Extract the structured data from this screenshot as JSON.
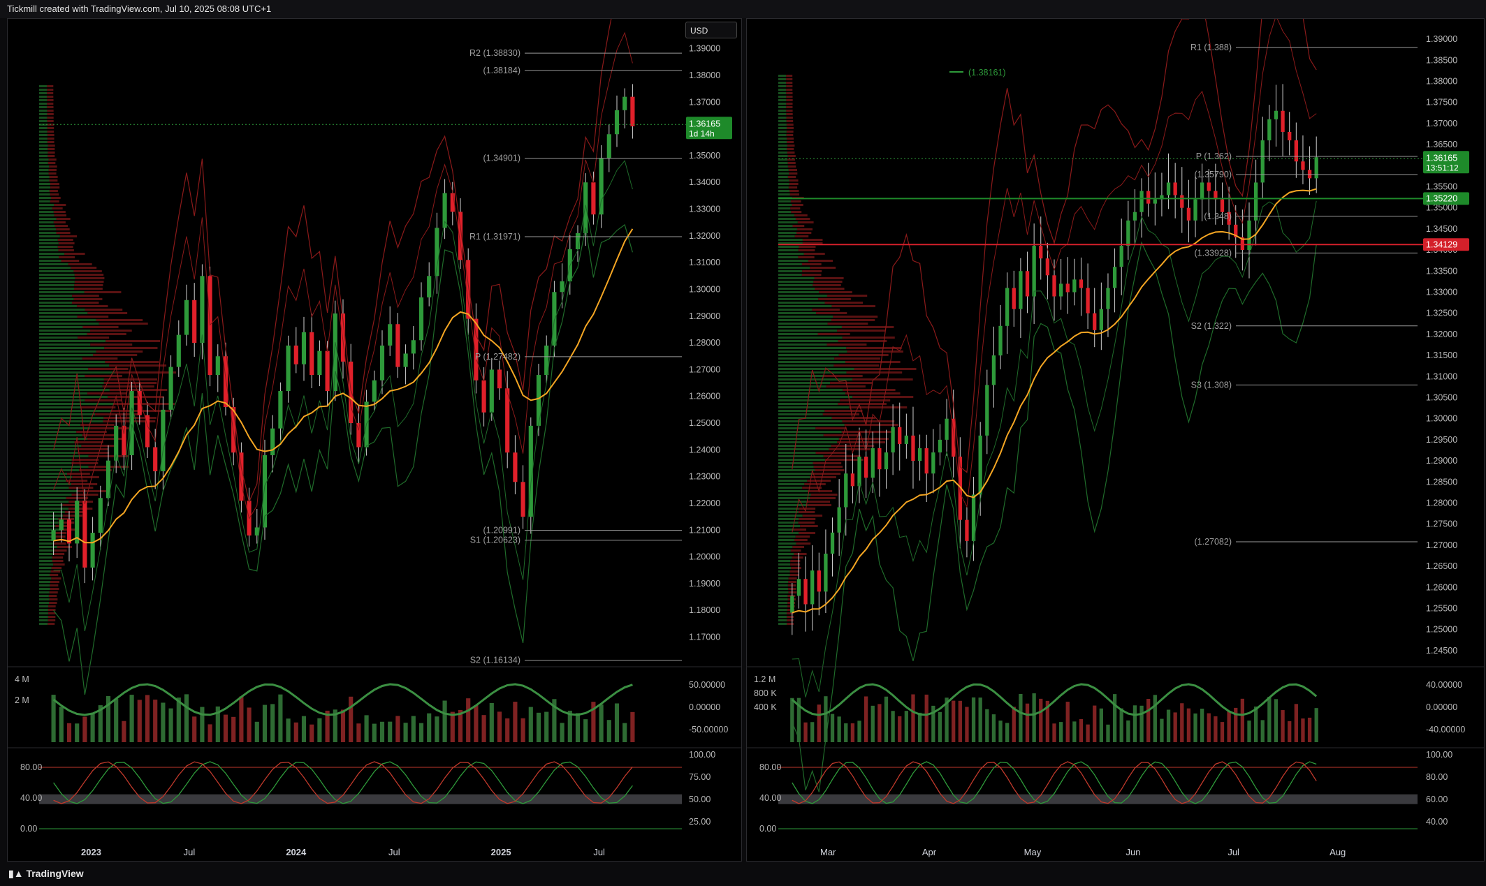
{
  "header": {
    "attribution": "Tickmill created with TradingView.com, Jul 10, 2025 08:08 UTC+1"
  },
  "footer": {
    "brand": "TradingView"
  },
  "colors": {
    "up": "#2e9a3a",
    "down": "#e0202a",
    "pivot": "#9a9a9a",
    "ma": "#f5a623",
    "bb_red": "#8b1a1a",
    "bb_green": "#1f6b2a"
  },
  "chart_data": [
    {
      "type": "candlestick",
      "title": "",
      "currency_button": "USD",
      "x_ticks": [
        "2023",
        "Jul",
        "2024",
        "Jul",
        "2025",
        "Jul"
      ],
      "y_ticks": [
        "1.39000",
        "1.38000",
        "1.37000",
        "1.36000",
        "1.35000",
        "1.34000",
        "1.33000",
        "1.32000",
        "1.31000",
        "1.30000",
        "1.29000",
        "1.28000",
        "1.27000",
        "1.26000",
        "1.25000",
        "1.24000",
        "1.23000",
        "1.22000",
        "1.21000",
        "1.20000",
        "1.19000",
        "1.18000",
        "1.17000"
      ],
      "ylim": [
        1.161,
        1.392
      ],
      "last_price": {
        "value": "1.36165",
        "countdown": "1d 14h"
      },
      "levels": [
        {
          "label": "R2 (1.38830)",
          "value": 1.3883
        },
        {
          "label": "(1.38184)",
          "value": 1.38184
        },
        {
          "label": "(1.34901)",
          "value": 1.34901
        },
        {
          "label": "R1 (1.31971)",
          "value": 1.31971
        },
        {
          "label": "P (1.27482)",
          "value": 1.27482
        },
        {
          "label": "(1.20991)",
          "value": 1.20991
        },
        {
          "label": "S1 (1.20623)",
          "value": 1.20623
        },
        {
          "label": "S2 (1.16134)",
          "value": 1.16134
        }
      ],
      "closes": [
        1.21,
        1.214,
        1.205,
        1.221,
        1.196,
        1.209,
        1.222,
        1.236,
        1.249,
        1.238,
        1.262,
        1.253,
        1.241,
        1.232,
        1.255,
        1.271,
        1.283,
        1.296,
        1.28,
        1.305,
        1.268,
        1.275,
        1.256,
        1.239,
        1.221,
        1.208,
        1.211,
        1.238,
        1.248,
        1.262,
        1.279,
        1.272,
        1.284,
        1.268,
        1.277,
        1.262,
        1.291,
        1.273,
        1.25,
        1.241,
        1.258,
        1.266,
        1.279,
        1.287,
        1.271,
        1.276,
        1.281,
        1.297,
        1.305,
        1.323,
        1.336,
        1.329,
        1.311,
        1.289,
        1.266,
        1.254,
        1.27,
        1.263,
        1.239,
        1.228,
        1.215,
        1.249,
        1.268,
        1.279,
        1.299,
        1.303,
        1.315,
        1.321,
        1.34,
        1.328,
        1.349,
        1.358,
        1.367,
        1.372,
        1.361
      ],
      "volume": {
        "y_ticks": [
          "4 M",
          "2 M"
        ]
      },
      "oscillator_a": {
        "y_ticks": [
          "50.00000",
          "0.00000",
          "-50.00000"
        ]
      },
      "oscillator_b": {
        "y_ticks_left": [
          "80.00",
          "40.00",
          "0.00"
        ],
        "y_ticks_right": [
          "100.00",
          "75.00",
          "50.00",
          "25.00"
        ]
      }
    },
    {
      "type": "candlestick",
      "title": "",
      "x_ticks": [
        "Mar",
        "Apr",
        "May",
        "Jun",
        "Jul",
        "Aug"
      ],
      "y_ticks": [
        "1.39000",
        "1.38500",
        "1.38000",
        "1.37500",
        "1.37000",
        "1.36500",
        "1.36000",
        "1.35500",
        "1.35000",
        "1.34500",
        "1.34000",
        "1.33500",
        "1.33000",
        "1.32500",
        "1.32000",
        "1.31500",
        "1.31000",
        "1.30500",
        "1.30000",
        "1.29500",
        "1.29000",
        "1.28500",
        "1.28000",
        "1.27500",
        "1.27000",
        "1.26500",
        "1.26000",
        "1.25500",
        "1.25000",
        "1.24500"
      ],
      "ylim": [
        1.2425,
        1.3915
      ],
      "legend_value": "(1.38161)",
      "last_price": {
        "value": "1.36165",
        "countdown": "13:51:12"
      },
      "price_tags": [
        {
          "value": "1.35220",
          "color": "#1e8a2a"
        },
        {
          "value": "1.34129",
          "color": "#d4202a"
        }
      ],
      "levels": [
        {
          "label": "R1 (1.388)",
          "value": 1.388
        },
        {
          "label": "(1.35790)",
          "value": 1.3579
        },
        {
          "label": "P (1.362)",
          "value": 1.3622
        },
        {
          "label": "(1.348)",
          "value": 1.348
        },
        {
          "label": "(1.33928)",
          "value": 1.33928
        },
        {
          "label": "S2 (1.322)",
          "value": 1.322
        },
        {
          "label": "S3 (1.308)",
          "value": 1.308
        },
        {
          "label": "(1.27082)",
          "value": 1.27082
        }
      ],
      "closes": [
        1.258,
        1.262,
        1.256,
        1.264,
        1.259,
        1.268,
        1.273,
        1.279,
        1.287,
        1.284,
        1.291,
        1.286,
        1.293,
        1.288,
        1.292,
        1.298,
        1.294,
        1.296,
        1.29,
        1.293,
        1.287,
        1.292,
        1.295,
        1.3,
        1.291,
        1.276,
        1.271,
        1.282,
        1.296,
        1.308,
        1.315,
        1.322,
        1.331,
        1.326,
        1.335,
        1.329,
        1.341,
        1.338,
        1.334,
        1.329,
        1.332,
        1.33,
        1.333,
        1.331,
        1.325,
        1.321,
        1.326,
        1.331,
        1.336,
        1.341,
        1.347,
        1.349,
        1.354,
        1.351,
        1.352,
        1.353,
        1.356,
        1.353,
        1.35,
        1.347,
        1.352,
        1.356,
        1.354,
        1.352,
        1.349,
        1.346,
        1.343,
        1.34,
        1.347,
        1.356,
        1.366,
        1.371,
        1.373,
        1.368,
        1.366,
        1.361,
        1.359,
        1.357,
        1.362
      ],
      "volume": {
        "y_ticks": [
          "1.2 M",
          "800 K",
          "400 K"
        ]
      },
      "oscillator_a": {
        "y_ticks": [
          "40.00000",
          "0.00000",
          "-40.00000"
        ]
      },
      "oscillator_b": {
        "y_ticks_left": [
          "80.00",
          "40.00",
          "0.00"
        ],
        "y_ticks_right": [
          "100.00",
          "80.00",
          "60.00",
          "40.00"
        ]
      }
    }
  ]
}
